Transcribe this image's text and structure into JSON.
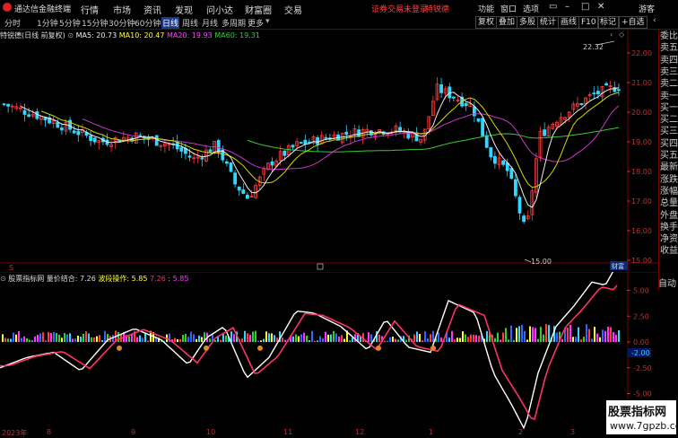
{
  "titlebar": {
    "app_title": "通达信金融终端",
    "menus": [
      "行情",
      "市场",
      "资讯",
      "发现",
      "问小达",
      "财富圈",
      "交易"
    ],
    "warning": "证券交易未登录",
    "stock_name": "特锐德",
    "right_menus": [
      "功能",
      "窗口",
      "选项"
    ],
    "guest": "游客"
  },
  "toolbar": {
    "periods": [
      "分时",
      "1分钟",
      "5分钟",
      "15分钟",
      "30分钟",
      "60分钟",
      "日线",
      "周线",
      "月线",
      "多周期",
      "更多"
    ],
    "active_period": "日线",
    "buttons": [
      "复权",
      "叠加",
      "多股",
      "统计",
      "画线",
      "F10",
      "标记",
      "+自选"
    ]
  },
  "main_info": {
    "stock_label": "特锐德(日线 前复权)",
    "ma5": "MA5: 20.73",
    "ma10": "MA10: 20.47",
    "ma20": "MA20: 19.93",
    "ma60": "MA60: 19.31"
  },
  "main_yaxis": [
    "22.00",
    "21.00",
    "20.00",
    "19.00",
    "18.00",
    "17.00",
    "16.00",
    "15.00"
  ],
  "main_annotations": {
    "high": "22.32",
    "low": "15.00",
    "price_tag": "财富"
  },
  "right_panel": [
    "委比",
    "卖五",
    "卖四",
    "卖三",
    "卖二",
    "卖一",
    "买一",
    "买二",
    "买三",
    "买四",
    "买五",
    "最新",
    "涨跌",
    "涨幅",
    "总量",
    "外盘",
    "换手",
    "净资",
    "收益"
  ],
  "indicator_info": {
    "name": "股票指标网",
    "line1": "量价结合: 7.26",
    "line2": "波段操作: 5.85",
    "v1": "7.26",
    "v2": "5.85"
  },
  "ind_yaxis": [
    "5.00",
    "2.50",
    "0.00",
    "-2.50",
    "-5.00"
  ],
  "ind_tag": "-2.00",
  "auto_label": "自动",
  "xaxis": [
    "2023年",
    "8",
    "9",
    "10",
    "11",
    "12",
    "1",
    "2",
    "3"
  ],
  "watermark": {
    "line1": "股票指标网",
    "line2": "www.7gpzb.com"
  },
  "colors": {
    "up": "#ff3b3b",
    "down": "#33d6ff",
    "ma5": "#ffffff",
    "ma10": "#ffff00",
    "ma20": "#ff33ff",
    "ma60": "#33cc33"
  }
}
